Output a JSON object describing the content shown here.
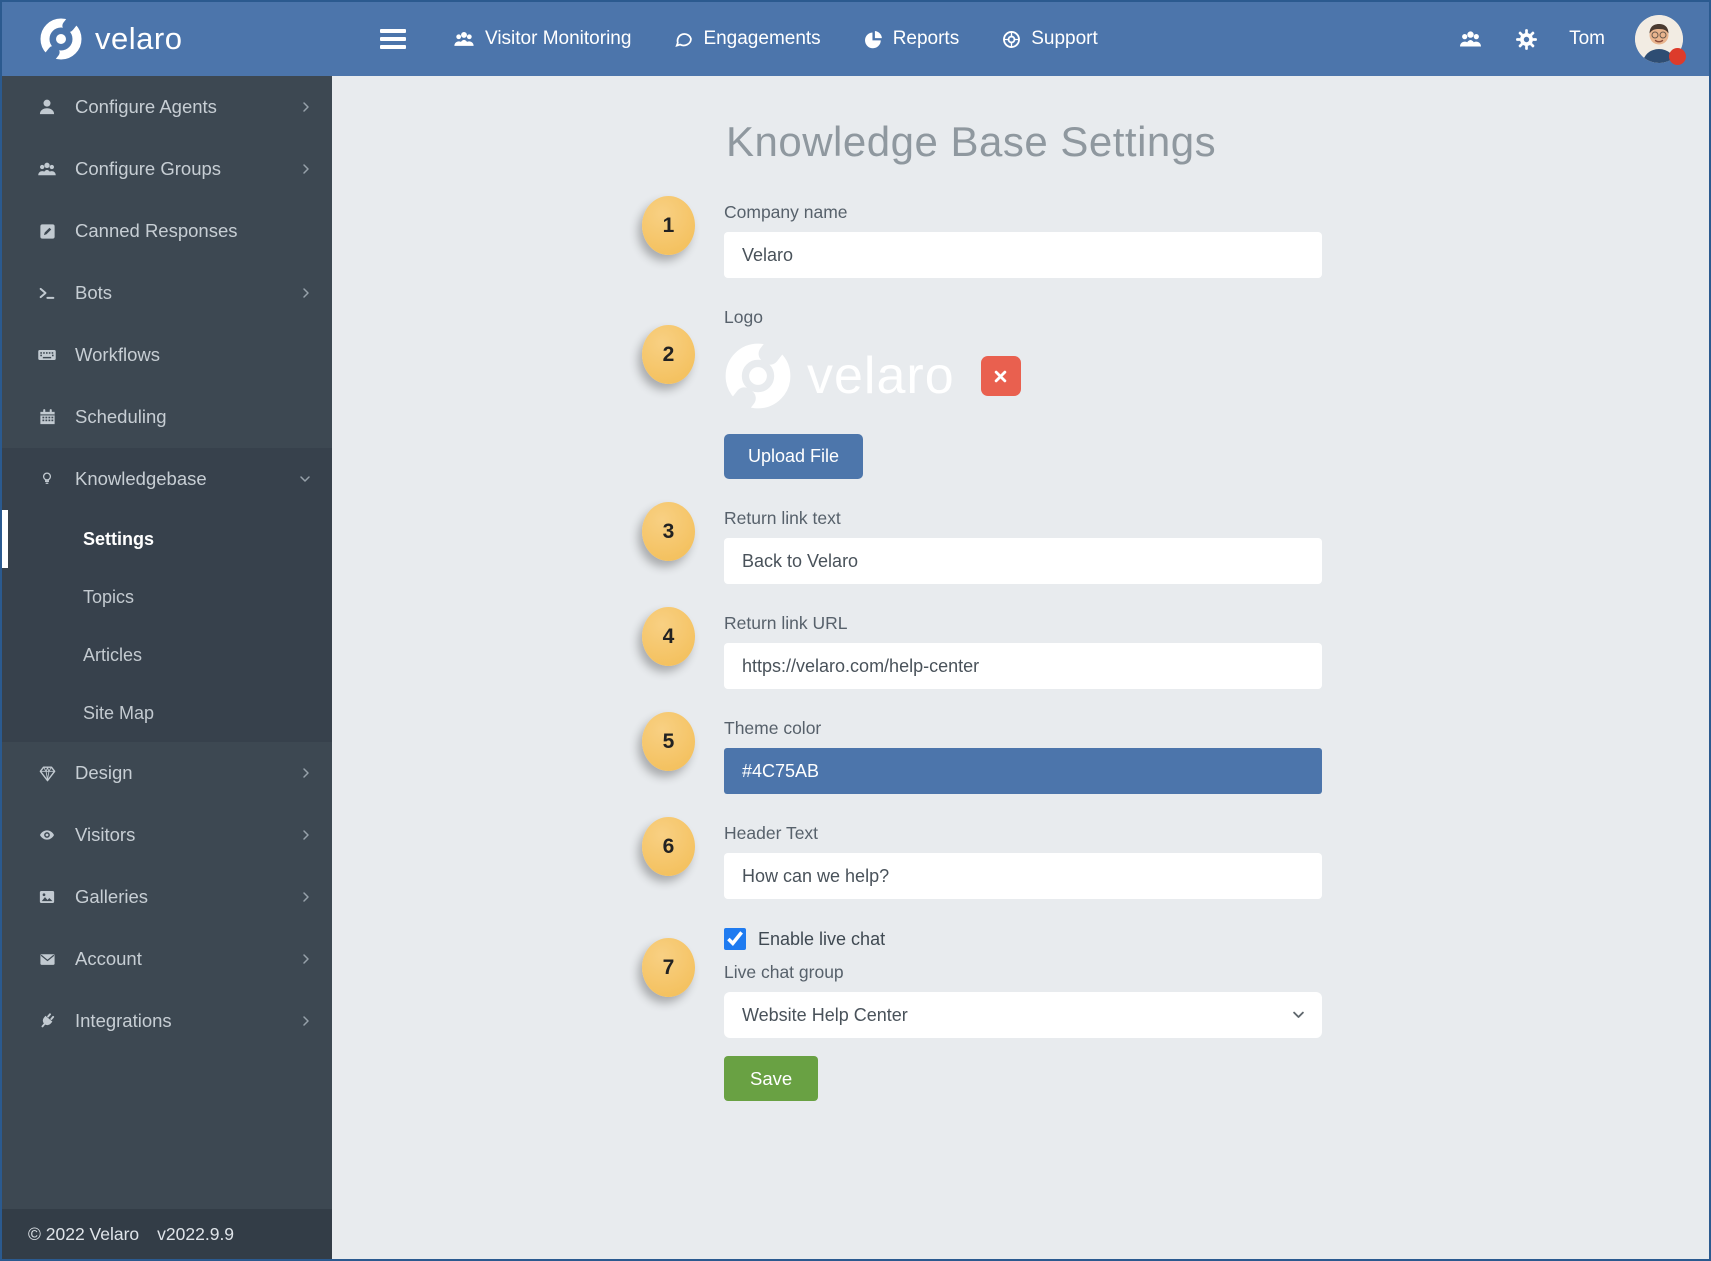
{
  "colors": {
    "navbar_blue": "#4C75AB",
    "sidebar_dark": "#3D4852",
    "theme_color": "#4C75AB",
    "save_green": "#69A143",
    "remove_red": "#E9604F",
    "badge_yellow": "#F5C366",
    "checkbox_blue": "#1F7BF0"
  },
  "navbar": {
    "brand": "velaro",
    "items": [
      {
        "label": "Visitor Monitoring",
        "icon": "users-icon"
      },
      {
        "label": "Engagements",
        "icon": "chat-bubble-icon"
      },
      {
        "label": "Reports",
        "icon": "pie-chart-icon"
      },
      {
        "label": "Support",
        "icon": "life-ring-icon"
      }
    ],
    "right_icons": [
      "people-icon",
      "gear-icon"
    ],
    "user_name": "Tom"
  },
  "sidebar": {
    "items": [
      {
        "label": "Configure Agents",
        "icon": "user-icon",
        "chevron": "right"
      },
      {
        "label": "Configure Groups",
        "icon": "users-icon",
        "chevron": "right"
      },
      {
        "label": "Canned Responses",
        "icon": "pencil-square-icon",
        "chevron": "none"
      },
      {
        "label": "Bots",
        "icon": "terminal-icon",
        "chevron": "right"
      },
      {
        "label": "Workflows",
        "icon": "keyboard-icon",
        "chevron": "none"
      },
      {
        "label": "Scheduling",
        "icon": "calendar-icon",
        "chevron": "none"
      },
      {
        "label": "Knowledgebase",
        "icon": "lightbulb-icon",
        "chevron": "down",
        "expanded": true,
        "children": [
          {
            "label": "Settings",
            "active": true
          },
          {
            "label": "Topics",
            "active": false
          },
          {
            "label": "Articles",
            "active": false
          },
          {
            "label": "Site Map",
            "active": false
          }
        ]
      },
      {
        "label": "Design",
        "icon": "gem-icon",
        "chevron": "right"
      },
      {
        "label": "Visitors",
        "icon": "eye-icon",
        "chevron": "right"
      },
      {
        "label": "Galleries",
        "icon": "image-icon",
        "chevron": "right"
      },
      {
        "label": "Account",
        "icon": "envelope-icon",
        "chevron": "right"
      },
      {
        "label": "Integrations",
        "icon": "plug-icon",
        "chevron": "right"
      }
    ],
    "footer": {
      "copyright": "© 2022 Velaro",
      "version": "v2022.9.9"
    }
  },
  "main": {
    "title": "Knowledge Base Settings",
    "fields": {
      "company_name": {
        "badge": "1",
        "label": "Company name",
        "value": "Velaro"
      },
      "logo": {
        "badge": "2",
        "label": "Logo",
        "logo_text": "velaro",
        "remove_icon": "x-icon",
        "upload_label": "Upload File"
      },
      "return_link_text": {
        "badge": "3",
        "label": "Return link text",
        "value": "Back to Velaro"
      },
      "return_link_url": {
        "badge": "4",
        "label": "Return link URL",
        "value": "https://velaro.com/help-center"
      },
      "theme_color": {
        "badge": "5",
        "label": "Theme color",
        "value": "#4C75AB"
      },
      "header_text": {
        "badge": "6",
        "label": "Header Text",
        "value": "How can we help?"
      },
      "live_chat": {
        "badge": "7",
        "checkbox_label": "Enable live chat",
        "checked_attr": "checked",
        "group_label": "Live chat group",
        "group_value": "Website Help Center"
      }
    },
    "save_label": "Save"
  }
}
